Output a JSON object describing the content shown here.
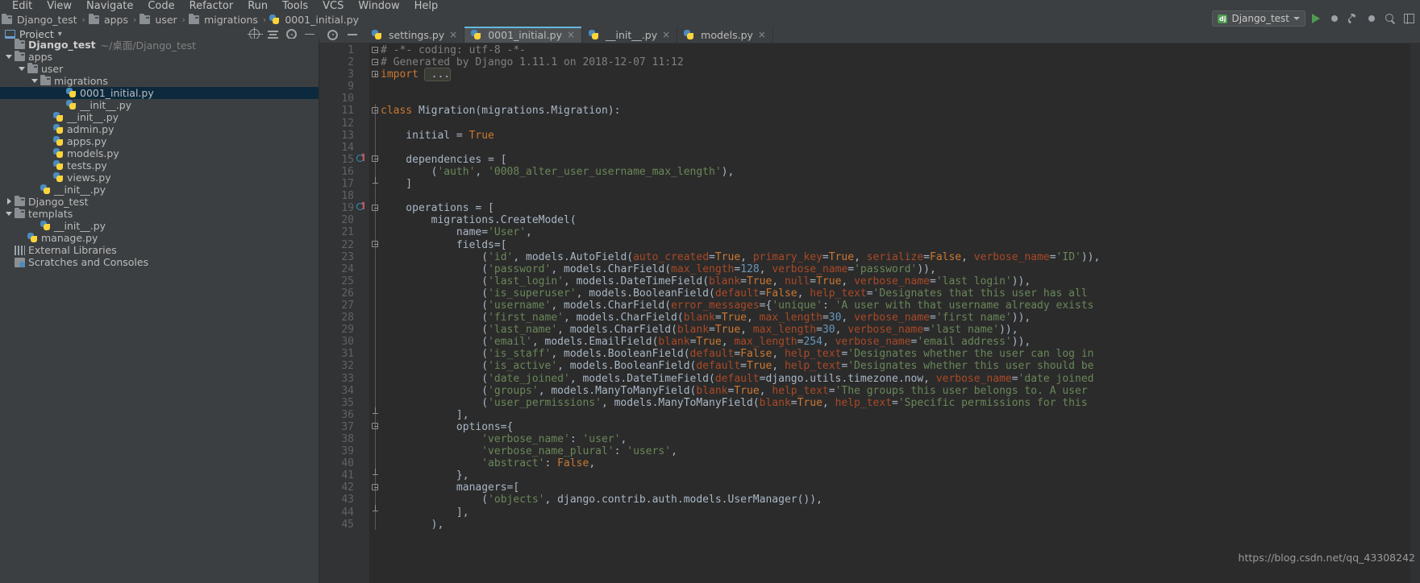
{
  "menubar": {
    "items": [
      "Edit",
      "View",
      "Navigate",
      "Code",
      "Refactor",
      "Run",
      "Tools",
      "VCS",
      "Window",
      "Help"
    ]
  },
  "breadcrumb": {
    "items": [
      {
        "label": "Django_test",
        "icon": "folder-icon"
      },
      {
        "label": "apps",
        "icon": "folder-icon"
      },
      {
        "label": "user",
        "icon": "folder-icon"
      },
      {
        "label": "migrations",
        "icon": "folder-icon"
      },
      {
        "label": "0001_initial.py",
        "icon": "python-file-icon"
      }
    ],
    "separator": "›"
  },
  "runbar": {
    "config_badge": "dj",
    "config_label": "Django_test",
    "run_title": "Run",
    "debug_title": "Debug",
    "build_title": "Build",
    "layout_title": "Layout",
    "search_title": "Search"
  },
  "project_panel": {
    "title": "Project",
    "caret": "▾",
    "actions": [
      "locate-icon",
      "collapse-all-icon",
      "settings-icon",
      "hide-icon"
    ],
    "tree": [
      {
        "depth": 0,
        "twist": "none",
        "icon": "folder-icon",
        "label": "Django_test",
        "bold": true,
        "path": "~/桌面/Django_test",
        "selected": false
      },
      {
        "depth": 0,
        "twist": "open",
        "icon": "folder-icon",
        "label": "apps",
        "bold": false,
        "path": "",
        "selected": false
      },
      {
        "depth": 1,
        "twist": "open",
        "icon": "folder-icon",
        "label": "user",
        "bold": false,
        "path": "",
        "selected": false
      },
      {
        "depth": 2,
        "twist": "open",
        "icon": "folder-icon",
        "label": "migrations",
        "bold": false,
        "path": "",
        "selected": false
      },
      {
        "depth": 4,
        "twist": "none",
        "icon": "python-file-icon",
        "label": "0001_initial.py",
        "bold": false,
        "path": "",
        "selected": true
      },
      {
        "depth": 4,
        "twist": "none",
        "icon": "python-file-icon",
        "label": "__init__.py",
        "bold": false,
        "path": "",
        "selected": false
      },
      {
        "depth": 3,
        "twist": "none",
        "icon": "python-file-icon",
        "label": "__init__.py",
        "bold": false,
        "path": "",
        "selected": false
      },
      {
        "depth": 3,
        "twist": "none",
        "icon": "python-file-icon",
        "label": "admin.py",
        "bold": false,
        "path": "",
        "selected": false
      },
      {
        "depth": 3,
        "twist": "none",
        "icon": "python-file-icon",
        "label": "apps.py",
        "bold": false,
        "path": "",
        "selected": false
      },
      {
        "depth": 3,
        "twist": "none",
        "icon": "python-file-icon",
        "label": "models.py",
        "bold": false,
        "path": "",
        "selected": false
      },
      {
        "depth": 3,
        "twist": "none",
        "icon": "python-file-icon",
        "label": "tests.py",
        "bold": false,
        "path": "",
        "selected": false
      },
      {
        "depth": 3,
        "twist": "none",
        "icon": "python-file-icon",
        "label": "views.py",
        "bold": false,
        "path": "",
        "selected": false
      },
      {
        "depth": 2,
        "twist": "none",
        "icon": "python-file-icon",
        "label": "__init__.py",
        "bold": false,
        "path": "",
        "selected": false
      },
      {
        "depth": 0,
        "twist": "closed",
        "icon": "folder-icon",
        "label": "Django_test",
        "bold": false,
        "path": "",
        "selected": false
      },
      {
        "depth": 0,
        "twist": "open",
        "icon": "folder-icon",
        "label": "templats",
        "bold": false,
        "path": "",
        "selected": false
      },
      {
        "depth": 2,
        "twist": "none",
        "icon": "python-file-icon",
        "label": "__init__.py",
        "bold": false,
        "path": "",
        "selected": false
      },
      {
        "depth": 1,
        "twist": "none",
        "icon": "python-file-icon",
        "label": "manage.py",
        "bold": false,
        "path": "",
        "selected": false
      },
      {
        "depth": 0,
        "twist": "none",
        "icon": "library-icon",
        "label": "External Libraries",
        "bold": false,
        "path": "",
        "selected": false
      },
      {
        "depth": 0,
        "twist": "none",
        "icon": "scratches-icon",
        "label": "Scratches and Consoles",
        "bold": false,
        "path": "",
        "selected": false
      }
    ]
  },
  "editor_tabs": [
    {
      "label": "settings.py",
      "active": false,
      "close": "×"
    },
    {
      "label": "0001_initial.py",
      "active": true,
      "close": "×"
    },
    {
      "label": "__init__.py",
      "active": false,
      "close": "×"
    },
    {
      "label": "models.py",
      "active": false,
      "close": "×"
    }
  ],
  "editor": {
    "file": "0001_initial.py",
    "line_numbers": [
      1,
      2,
      3,
      9,
      10,
      11,
      12,
      13,
      14,
      15,
      16,
      17,
      18,
      19,
      20,
      21,
      22,
      23,
      24,
      25,
      26,
      27,
      28,
      29,
      30,
      31,
      32,
      33,
      34,
      35,
      36,
      37,
      38,
      39,
      40,
      41,
      42,
      43,
      44,
      45
    ],
    "lines": [
      "# -*- coding: utf-8 -*-",
      "# Generated by Django 1.11.1 on 2018-12-07 11:12",
      "import ...",
      "",
      "",
      "class Migration(migrations.Migration):",
      "",
      "    initial = True",
      "",
      "    dependencies = [",
      "        ('auth', '0008_alter_user_username_max_length'),",
      "    ]",
      "",
      "    operations = [",
      "        migrations.CreateModel(",
      "            name='User',",
      "            fields=[",
      "                ('id', models.AutoField(auto_created=True, primary_key=True, serialize=False, verbose_name='ID')),",
      "                ('password', models.CharField(max_length=128, verbose_name='password')),",
      "                ('last_login', models.DateTimeField(blank=True, null=True, verbose_name='last login')),",
      "                ('is_superuser', models.BooleanField(default=False, help_text='Designates that this user has all ",
      "                ('username', models.CharField(error_messages={'unique': 'A user with that username already exists",
      "                ('first_name', models.CharField(blank=True, max_length=30, verbose_name='first name')),",
      "                ('last_name', models.CharField(blank=True, max_length=30, verbose_name='last name')),",
      "                ('email', models.EmailField(blank=True, max_length=254, verbose_name='email address')),",
      "                ('is_staff', models.BooleanField(default=False, help_text='Designates whether the user can log in",
      "                ('is_active', models.BooleanField(default=True, help_text='Designates whether this user should be",
      "                ('date_joined', models.DateTimeField(default=django.utils.timezone.now, verbose_name='date joined",
      "                ('groups', models.ManyToManyField(blank=True, help_text='The groups this user belongs to. A user ",
      "                ('user_permissions', models.ManyToManyField(blank=True, help_text='Specific permissions for this ",
      "            ],",
      "            options={",
      "                'verbose_name': 'user',",
      "                'verbose_name_plural': 'users',",
      "                'abstract': False,",
      "            },",
      "            managers=[",
      "                ('objects', django.contrib.auth.models.UserManager()),",
      "            ],",
      "        ),"
    ],
    "folded_marker": "import ...",
    "override_gutter_lines": [
      15,
      19
    ]
  },
  "watermark": {
    "text": "https://blog.csdn.net/qq_43308242"
  },
  "colors": {
    "editor_bg": "#2b2b2b",
    "panel_bg": "#3c3f41",
    "gutter_bg": "#313335",
    "selection": "#0d293e",
    "accent_tab": "#62b8de",
    "keyword": "#cc7832",
    "string": "#6a8759",
    "number": "#6897bb",
    "comment": "#808080",
    "kwarg": "#aa4926",
    "text": "#a9b7c6"
  }
}
